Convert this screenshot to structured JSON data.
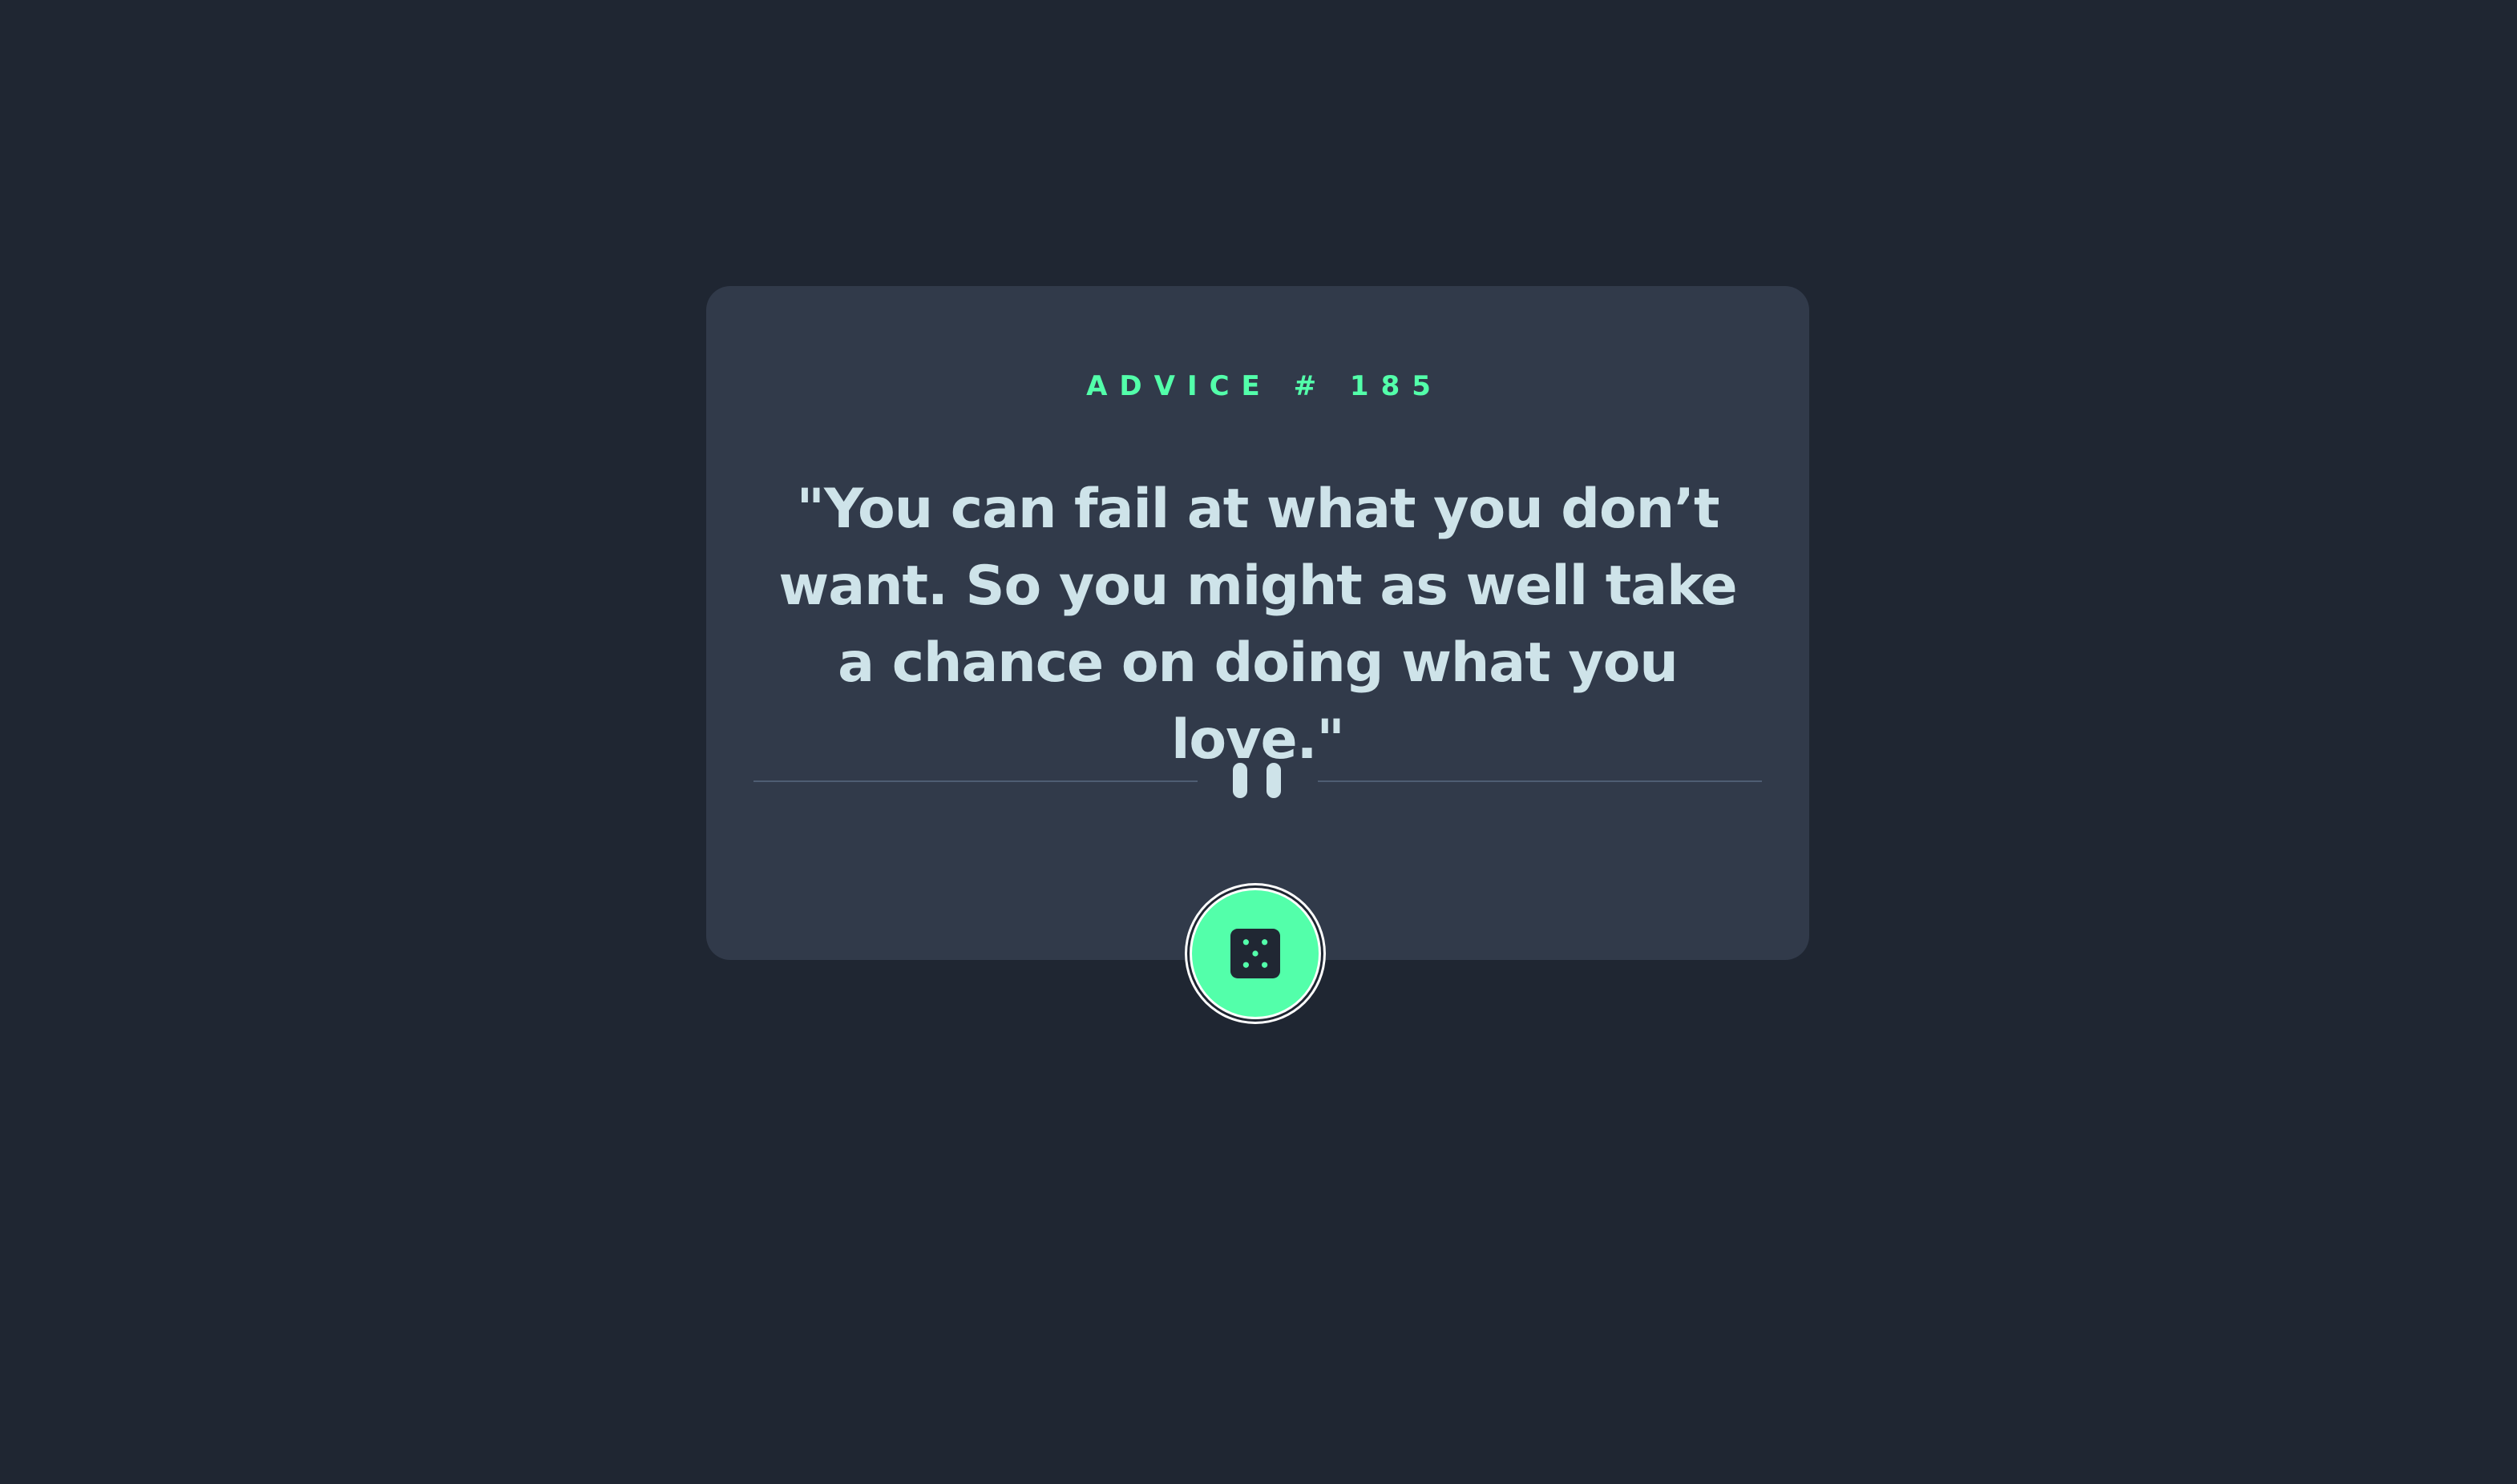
{
  "card": {
    "advice_label": "ADVICE # 185",
    "quote": "\"You can fail at what you don’t want. So you might as well take a chance on doing what you love.\""
  },
  "divider": {
    "icon": "pause-icon"
  },
  "action": {
    "icon": "dice-icon"
  },
  "colors": {
    "background": "#1f2632",
    "card": "#313a4a",
    "accent": "#53ffaa",
    "text": "#cee3e9",
    "divider": "#4e5d73"
  }
}
